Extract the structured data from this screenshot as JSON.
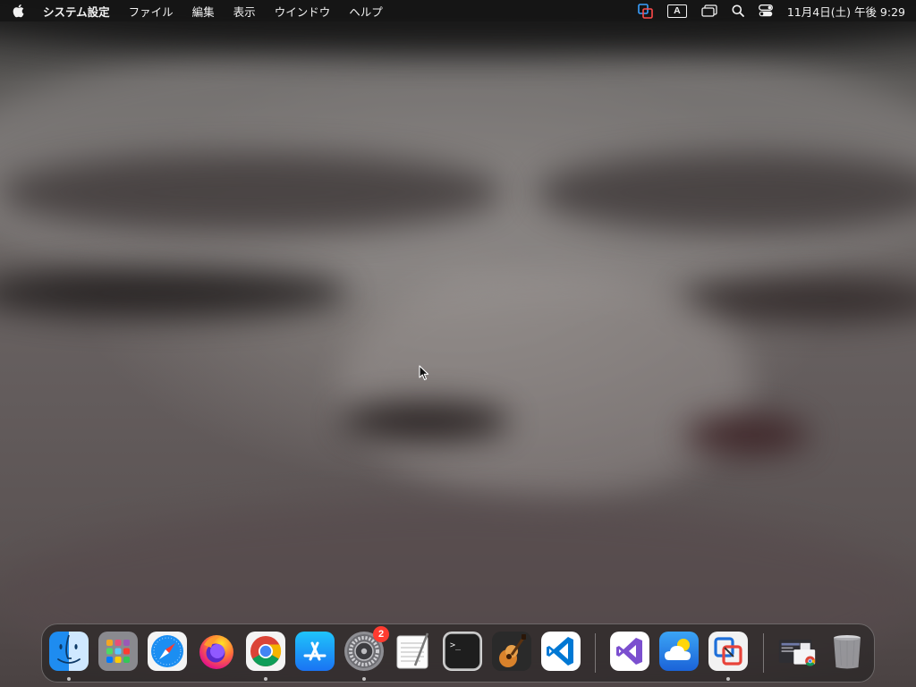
{
  "menubar": {
    "app_name": "システム設定",
    "items": [
      "ファイル",
      "編集",
      "表示",
      "ウインドウ",
      "ヘルプ"
    ],
    "input_source": "A",
    "clock": "11月4日(土)  午後 9:29"
  },
  "dock": {
    "items": [
      {
        "name": "Finder",
        "icon": "finder-icon",
        "running": true
      },
      {
        "name": "Launchpad",
        "icon": "launchpad-icon",
        "running": false
      },
      {
        "name": "Safari",
        "icon": "safari-icon",
        "running": false
      },
      {
        "name": "Firefox",
        "icon": "firefox-icon",
        "running": false
      },
      {
        "name": "Google Chrome",
        "icon": "chrome-icon",
        "running": true
      },
      {
        "name": "App Store",
        "icon": "app-store-icon",
        "running": false
      },
      {
        "name": "システム設定",
        "icon": "system-settings-icon",
        "running": true,
        "badge": "2"
      },
      {
        "name": "TextEdit",
        "icon": "textedit-icon",
        "running": false
      },
      {
        "name": "Terminal",
        "icon": "terminal-icon",
        "running": false
      },
      {
        "name": "GarageBand",
        "icon": "garageband-icon",
        "running": false
      },
      {
        "name": "Visual Studio Code",
        "icon": "vscode-icon",
        "running": false
      },
      {
        "name": "Visual Studio",
        "icon": "visual-studio-icon",
        "running": false
      },
      {
        "name": "Weather",
        "icon": "weather-icon",
        "running": false
      },
      {
        "name": "Microsoft Remote Desktop",
        "icon": "remote-desktop-icon",
        "running": true
      },
      {
        "name": "Chrome Apps",
        "icon": "chrome-apps-folder-icon",
        "running": false
      },
      {
        "name": "ゴミ箱",
        "icon": "trash-icon",
        "running": false
      }
    ]
  },
  "colors": {
    "menubar_bg": "#161616",
    "badge": "#ff3b30",
    "finder_blue": "#1e8cf0",
    "vscode_blue": "#0078d4",
    "vs_purple": "#7b4fcf"
  }
}
